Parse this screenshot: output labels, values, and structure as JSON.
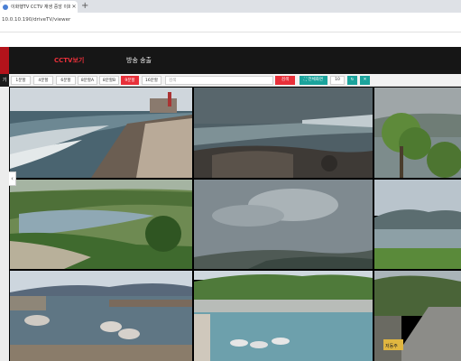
{
  "browser": {
    "tab_title": "이화행TV CCTV 재생 중앙 이화행",
    "url": "10.0.10.190/driveTV/viewer"
  },
  "header": {
    "nav": [
      {
        "label": "CCTV보기",
        "active": true
      },
      {
        "label": "방송 송출",
        "active": false
      }
    ]
  },
  "toolbar": {
    "side_label": "기",
    "layouts": [
      "1분할",
      "4분할",
      "6분할",
      "8분할A",
      "8분할B",
      "9분할",
      "16분할"
    ],
    "active_layout": "9분할",
    "search": {
      "placeholder": "검색",
      "value": "",
      "button": "검색"
    },
    "fullscreen_label": "전체화면",
    "interval_value": "10"
  },
  "colors": {
    "accent": "#e8303a",
    "header_bg": "#161616",
    "teal": "#1ba39c",
    "logo": "#b3131b"
  },
  "cameras": [
    {
      "scene": "surf-coast"
    },
    {
      "scene": "rocky-sea"
    },
    {
      "scene": "tree-harbor"
    },
    {
      "scene": "river-bank"
    },
    {
      "scene": "cloudy-sky"
    },
    {
      "scene": "valley-river"
    },
    {
      "scene": "fishing-port"
    },
    {
      "scene": "coastal-town"
    },
    {
      "scene": "road-crossing"
    }
  ],
  "overlays": {
    "road_sign": "저동주"
  }
}
